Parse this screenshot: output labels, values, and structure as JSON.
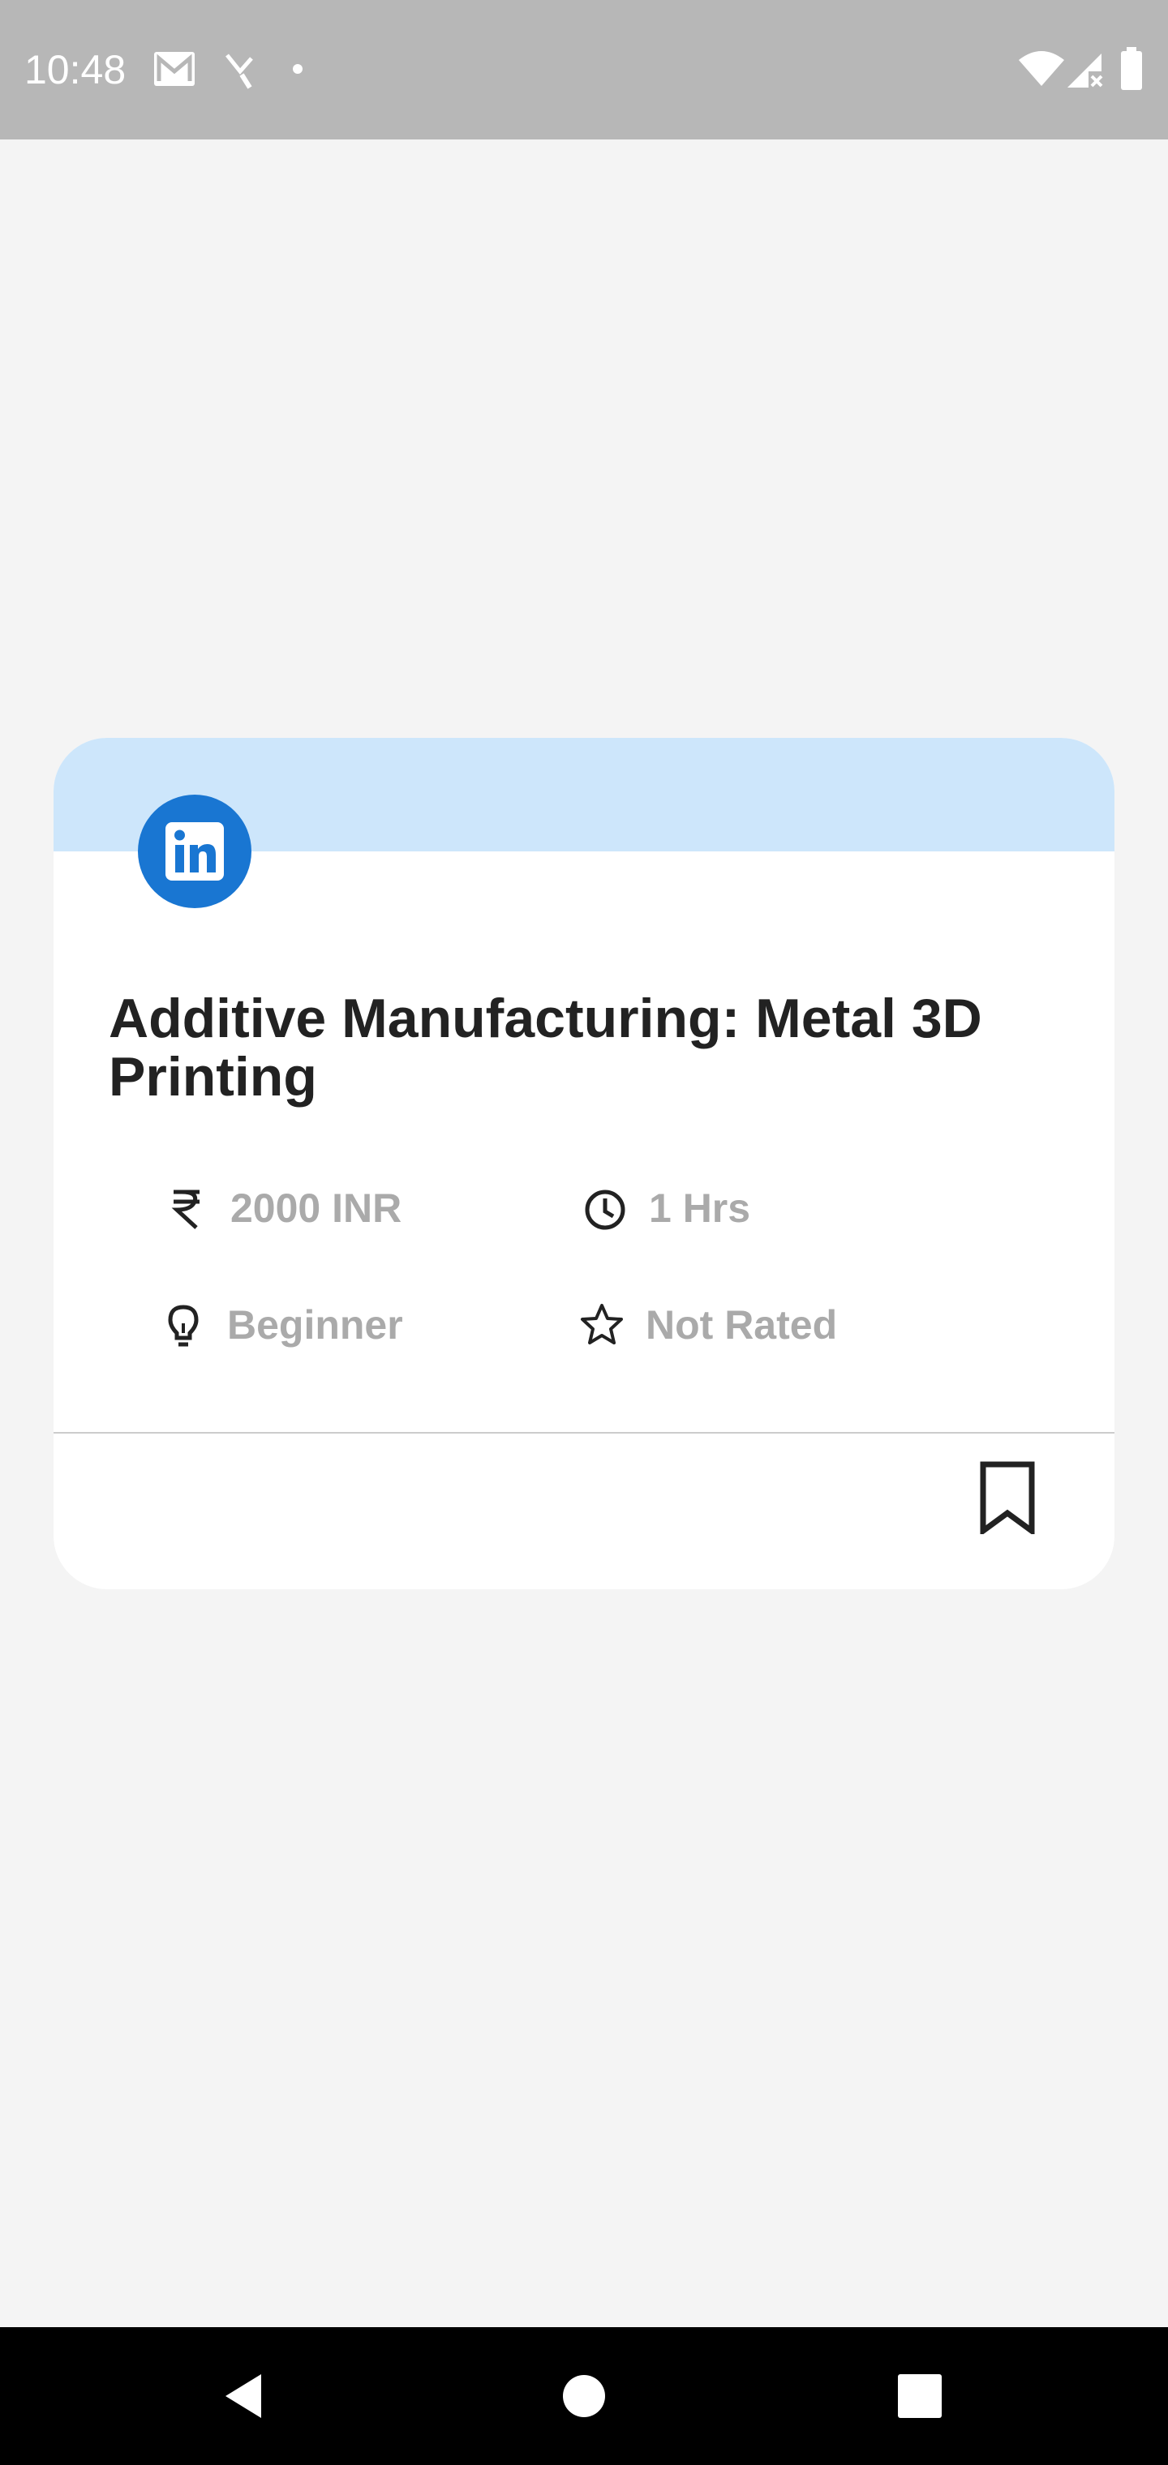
{
  "status_bar": {
    "time": "10:48",
    "left_icons": [
      "gmail-icon",
      "missed-call-icon",
      "notification-dot-icon"
    ],
    "right_icons": [
      "wifi-icon",
      "cell-signal-icon",
      "battery-icon"
    ]
  },
  "course_card": {
    "provider_logo": "linkedin-icon",
    "header_color": "#cde6fb",
    "logo_color": "#1976d2",
    "title": "Additive Manufacturing: Metal 3D Printing",
    "price": {
      "icon": "rupee-icon",
      "text": "2000 INR"
    },
    "duration": {
      "icon": "clock-icon",
      "text": "1 Hrs"
    },
    "level": {
      "icon": "lightbulb-icon",
      "text": "Beginner"
    },
    "rating": {
      "icon": "star-icon",
      "text": "Not Rated"
    },
    "bookmark_icon": "bookmark-icon"
  },
  "nav_bar": {
    "buttons": [
      "back-icon",
      "home-icon",
      "recents-icon"
    ]
  }
}
